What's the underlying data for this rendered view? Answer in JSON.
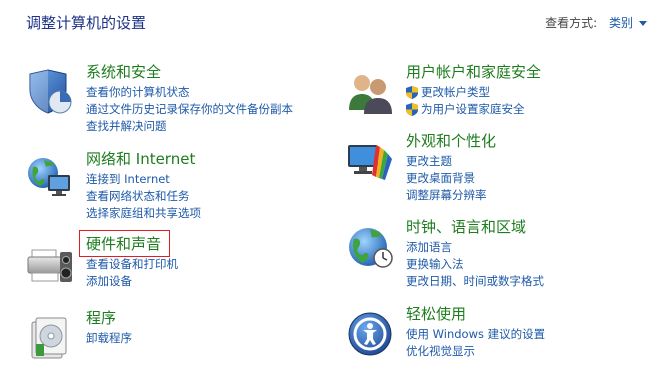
{
  "header": {
    "title": "调整计算机的设置",
    "view_by_label": "查看方式:",
    "view_by_value": "类别"
  },
  "left_column": [
    {
      "title": "系统和安全",
      "icon": "system-security-icon",
      "links": [
        {
          "label": "查看你的计算机状态"
        },
        {
          "label": "通过文件历史记录保存你的文件备份副本"
        },
        {
          "label": "查找并解决问题"
        }
      ]
    },
    {
      "title": "网络和 Internet",
      "icon": "network-internet-icon",
      "links": [
        {
          "label": "连接到 Internet"
        },
        {
          "label": "查看网络状态和任务"
        },
        {
          "label": "选择家庭组和共享选项"
        }
      ]
    },
    {
      "title": "硬件和声音",
      "icon": "hardware-sound-icon",
      "links": [
        {
          "label": "查看设备和打印机"
        },
        {
          "label": "添加设备"
        }
      ]
    },
    {
      "title": "程序",
      "icon": "programs-icon",
      "links": [
        {
          "label": "卸载程序"
        }
      ]
    }
  ],
  "right_column": [
    {
      "title": "用户帐户和家庭安全",
      "icon": "user-accounts-icon",
      "links": [
        {
          "label": "更改帐户类型",
          "shield": true
        },
        {
          "label": "为用户设置家庭安全",
          "shield": true
        }
      ]
    },
    {
      "title": "外观和个性化",
      "icon": "appearance-icon",
      "links": [
        {
          "label": "更改主题"
        },
        {
          "label": "更改桌面背景"
        },
        {
          "label": "调整屏幕分辨率"
        }
      ]
    },
    {
      "title": "时钟、语言和区域",
      "icon": "clock-language-region-icon",
      "links": [
        {
          "label": "添加语言"
        },
        {
          "label": "更换输入法"
        },
        {
          "label": "更改日期、时间或数字格式"
        }
      ]
    },
    {
      "title": "轻松使用",
      "icon": "ease-of-access-icon",
      "links": [
        {
          "label": "使用 Windows 建议的设置"
        },
        {
          "label": "优化视觉显示"
        }
      ]
    }
  ],
  "colors": {
    "title_green": "#1e7d1e",
    "link_blue": "#1e5aa8",
    "header_blue": "#1e3287",
    "highlight_red": "#e02020"
  }
}
